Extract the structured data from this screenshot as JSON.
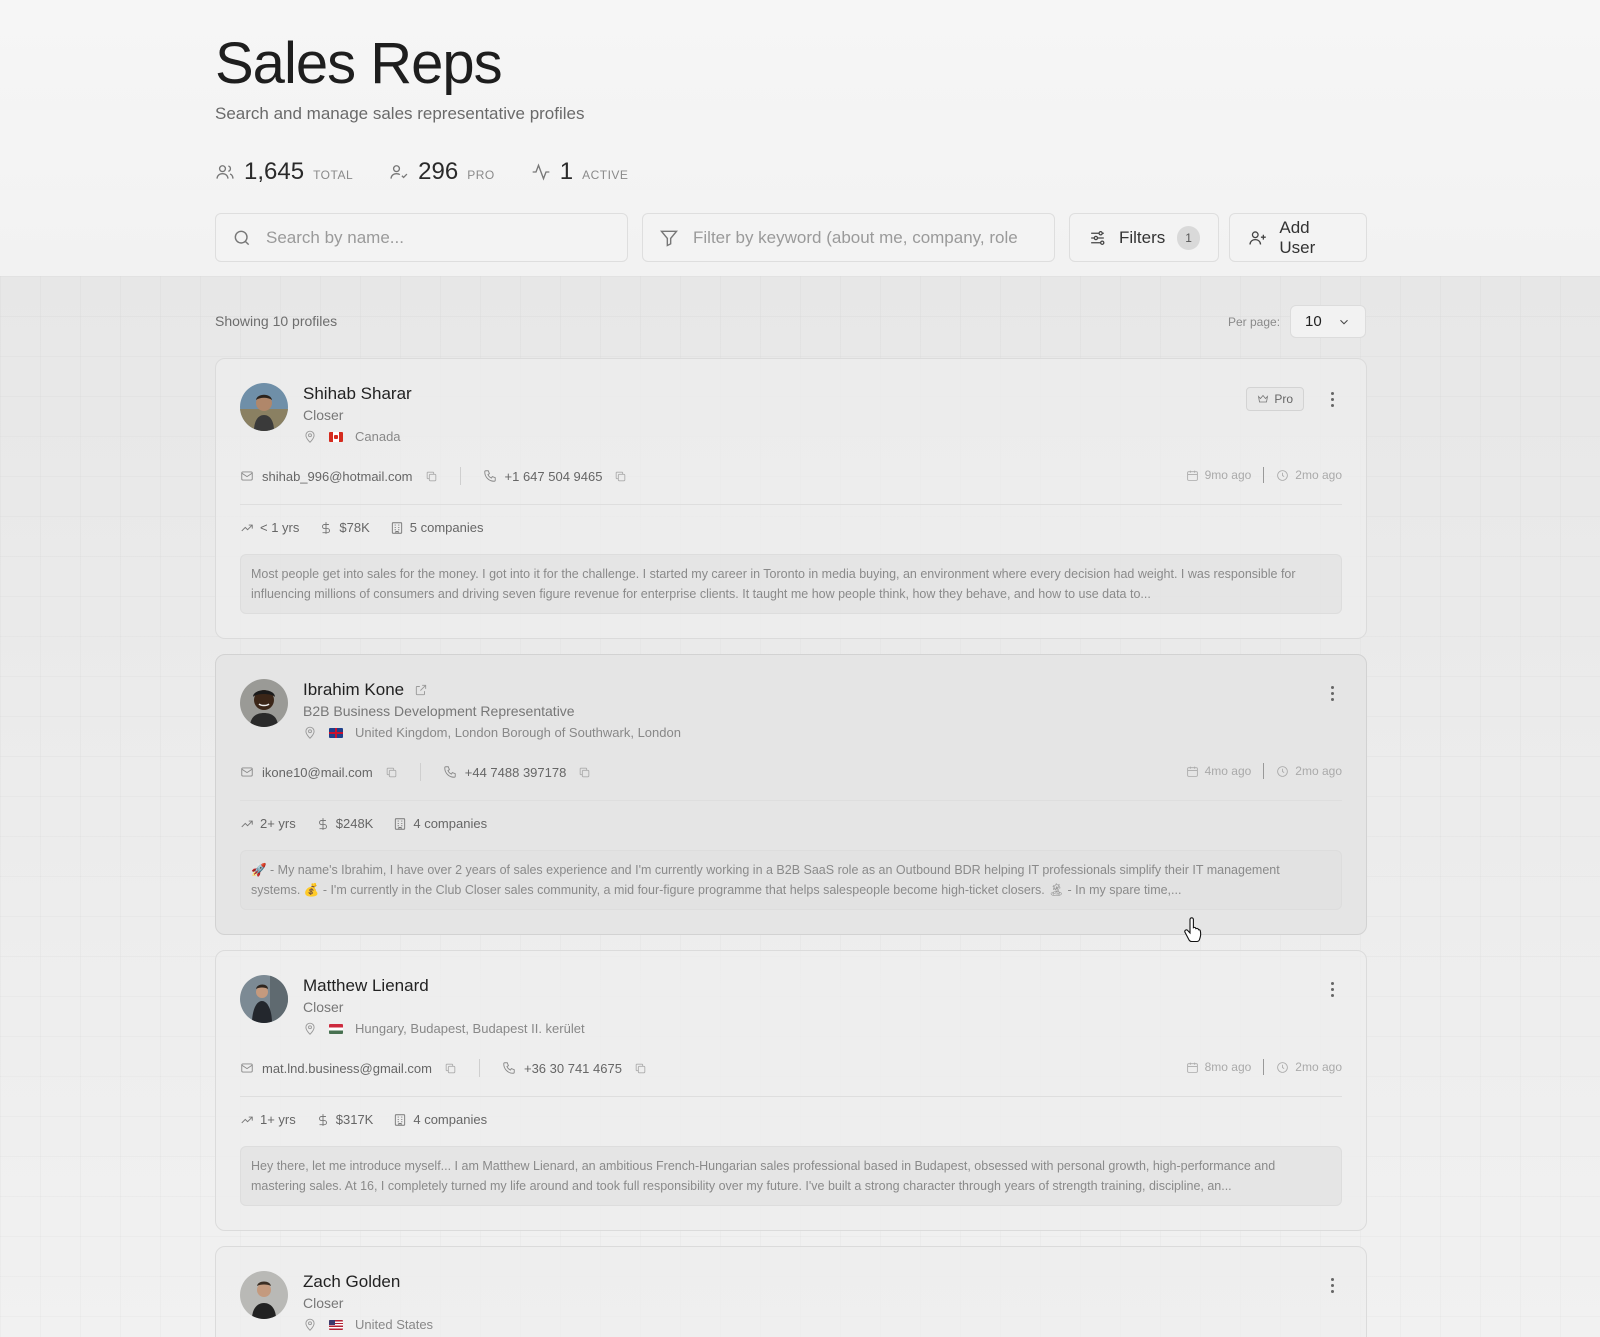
{
  "header": {
    "title": "Sales Reps",
    "subtitle": "Search and manage sales representative profiles"
  },
  "stats": [
    {
      "icon": "users-icon",
      "value": "1,645",
      "label": "TOTAL"
    },
    {
      "icon": "user-check-icon",
      "value": "296",
      "label": "PRO"
    },
    {
      "icon": "activity-icon",
      "value": "1",
      "label": "ACTIVE"
    }
  ],
  "toolbar": {
    "search_placeholder": "Search by name...",
    "keyword_placeholder": "Filter by keyword (about me, company, role",
    "filters_label": "Filters",
    "filters_count": "1",
    "add_user_label": "Add User"
  },
  "list": {
    "showing": "Showing 10 profiles",
    "per_page_label": "Per page:",
    "per_page_value": "10"
  },
  "profiles": [
    {
      "name": "Shihab Sharar",
      "role": "Closer",
      "location": "Canada",
      "flag": "CA",
      "pro": "Pro",
      "email": "shihab_996@hotmail.com",
      "phone": "+1 647 504 9465",
      "joined": "9mo ago",
      "active": "2mo ago",
      "experience": "< 1 yrs",
      "earnings": "$78K",
      "companies": "5 companies",
      "about": "Most people get into sales for the money. I got into it for the challenge. I started my career in Toronto in media buying, an environment where every decision had weight. I was responsible for influencing millions of consumers and driving seven figure revenue for enterprise clients. It taught me how people think, how they behave, and how to use data to..."
    },
    {
      "name": "Ibrahim Kone",
      "role": "B2B Business Development Representative",
      "location": "United Kingdom, London Borough of Southwark, London",
      "flag": "GB",
      "email": "ikone10@mail.com",
      "phone": "+44 7488 397178",
      "joined": "4mo ago",
      "active": "2mo ago",
      "experience": "2+ yrs",
      "earnings": "$248K",
      "companies": "4 companies",
      "about": "🚀 - My name's Ibrahim, I have over 2 years of sales experience and I'm currently working in a B2B SaaS role as an Outbound BDR helping IT professionals simplify their IT management systems. 💰 - I'm currently in the Club Closer sales community, a mid four-figure programme that helps salespeople become high-ticket closers. 🏝 - In my spare time,..."
    },
    {
      "name": "Matthew Lienard",
      "role": "Closer",
      "location": "Hungary, Budapest, Budapest II. kerület",
      "flag": "HU",
      "email": "mat.lnd.business@gmail.com",
      "phone": "+36 30 741 4675",
      "joined": "8mo ago",
      "active": "2mo ago",
      "experience": "1+ yrs",
      "earnings": "$317K",
      "companies": "4 companies",
      "about": "Hey there, let me introduce myself... I am Matthew Lienard, an ambitious French-Hungarian sales professional based in Budapest, obsessed with personal growth, high-performance and mastering sales. At 16, I completely turned my life around and took full responsibility over my future. I've built a strong character through years of strength training, discipline, an..."
    },
    {
      "name": "Zach Golden",
      "role": "Closer",
      "location": "United States",
      "flag": "US"
    }
  ],
  "colors": {
    "background": "#efefef",
    "card": "#eeeeee",
    "border": "#dbdbdb",
    "text": "#2b2b2b",
    "muted": "#8a8a8a",
    "canada_red": "#d52b1e",
    "hungary_green": "#477050"
  }
}
